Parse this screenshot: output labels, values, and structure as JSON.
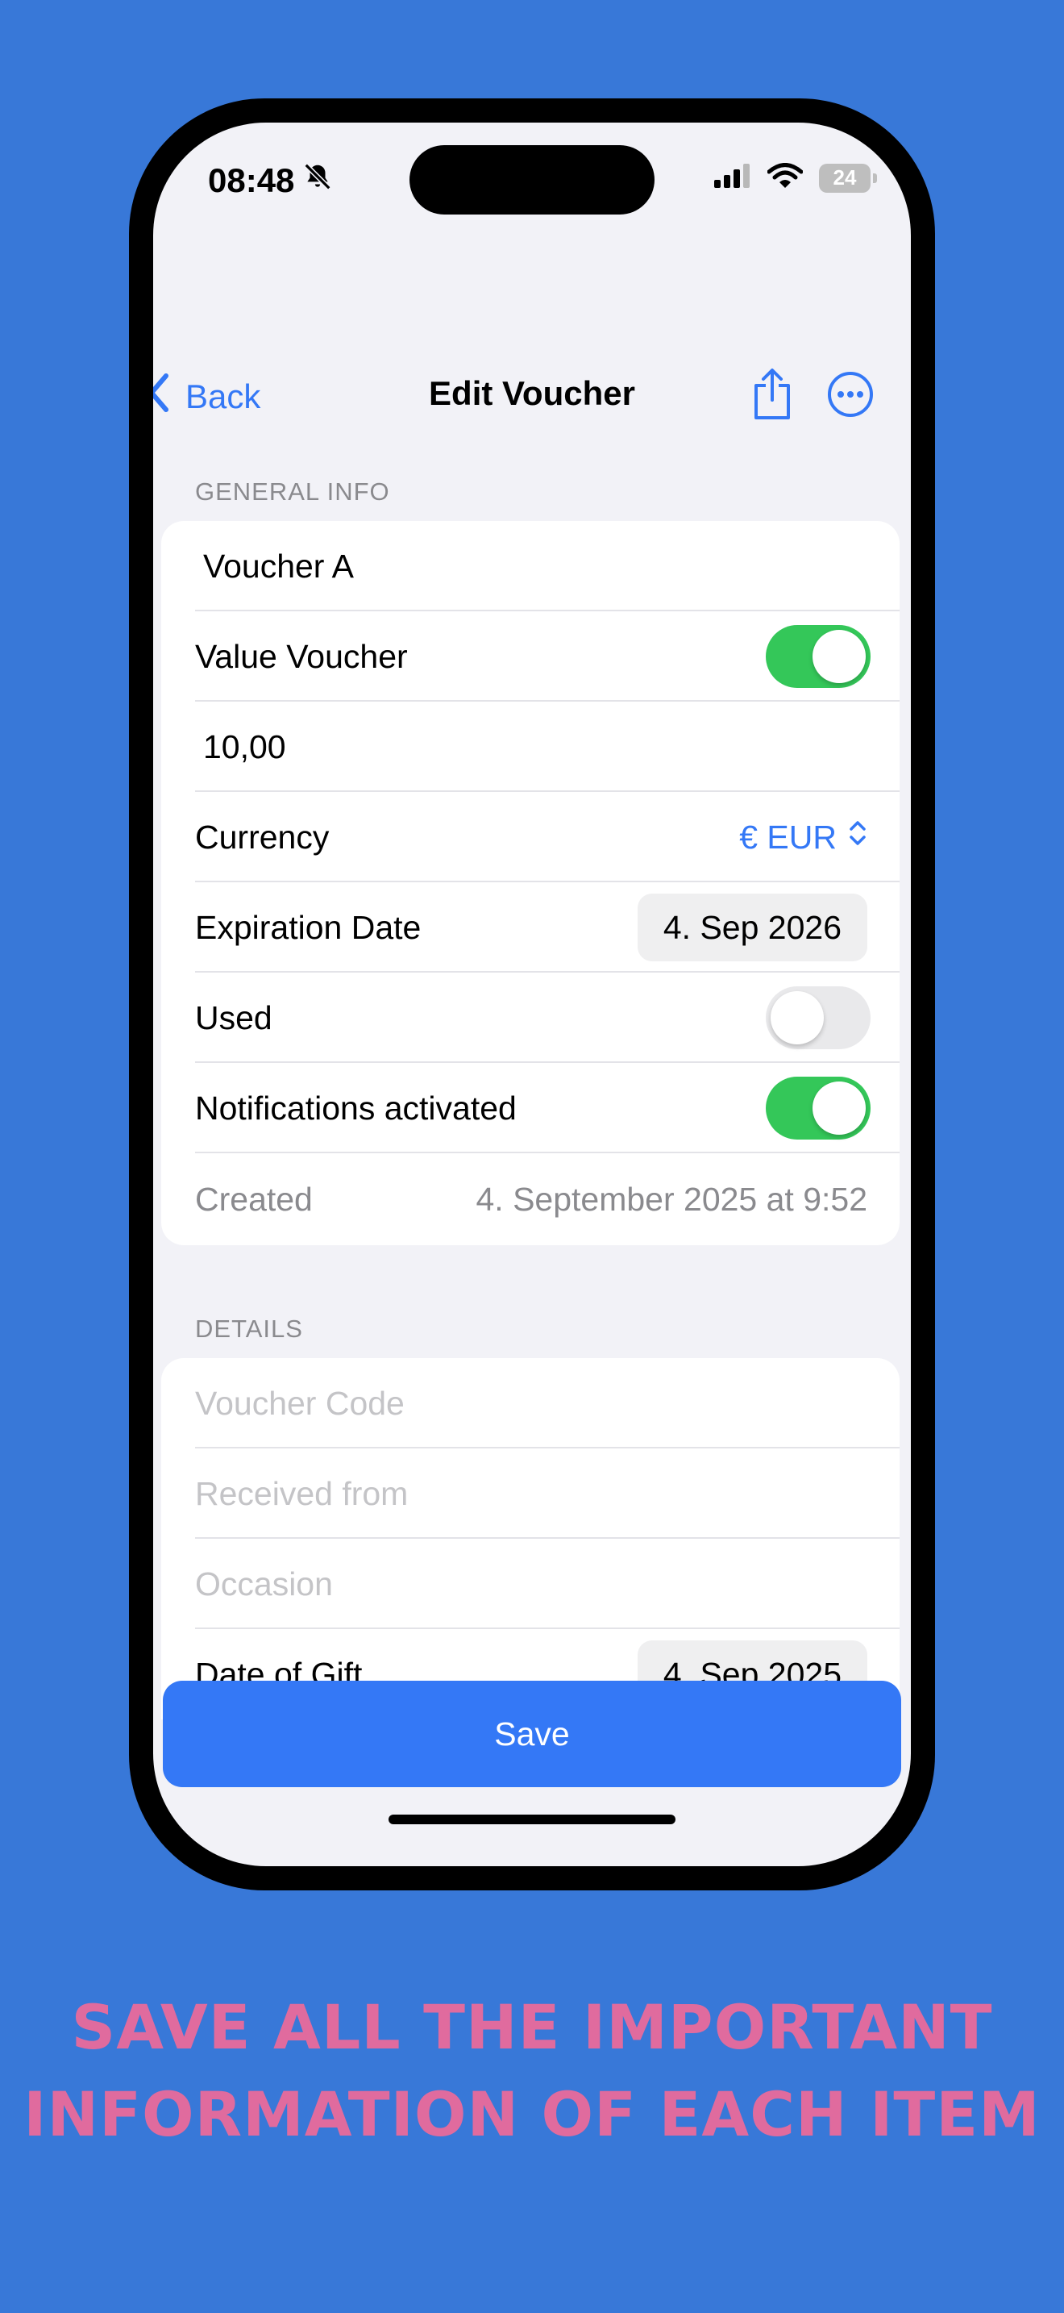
{
  "status_bar": {
    "time": "08:48",
    "battery": "24"
  },
  "nav": {
    "back_label": "Back",
    "title": "Edit Voucher"
  },
  "general": {
    "header": "GENERAL INFO",
    "name_value": "Voucher A",
    "value_voucher_label": "Value Voucher",
    "value_voucher_on": true,
    "amount_value": "10,00",
    "currency_label": "Currency",
    "currency_value": "€ EUR",
    "expiration_label": "Expiration Date",
    "expiration_value": "4. Sep 2026",
    "used_label": "Used",
    "used_on": false,
    "notifications_label": "Notifications activated",
    "notifications_on": true,
    "created_label": "Created",
    "created_value": "4. September 2025 at 9:52"
  },
  "details": {
    "header": "DETAILS",
    "code_placeholder": "Voucher Code",
    "received_placeholder": "Received from",
    "occasion_placeholder": "Occasion",
    "gift_date_label": "Date of Gift",
    "gift_date_value": "4. Sep 2025"
  },
  "save_label": "Save",
  "promo": {
    "line1": "SAVE ALL THE IMPORTANT",
    "line2": "INFORMATION OF EACH ITEM"
  },
  "colors": {
    "background": "#3878D8",
    "accent": "#3478F6",
    "toggle_on": "#34C759",
    "promo_text": "#E06B9E"
  },
  "icons": [
    "bell-slash-icon",
    "cellular-icon",
    "wifi-icon",
    "battery-icon",
    "chevron-left-icon",
    "share-icon",
    "more-icon",
    "chevron-up-down-icon"
  ]
}
